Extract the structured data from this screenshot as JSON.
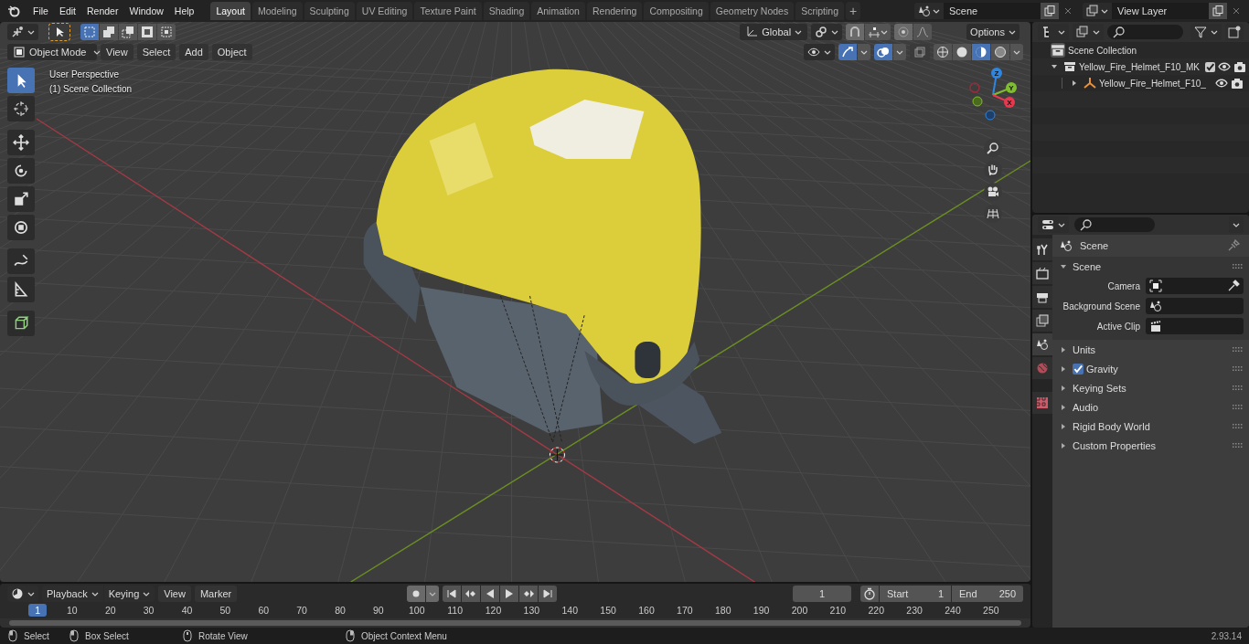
{
  "menu_bar": {
    "menus": [
      "File",
      "Edit",
      "Render",
      "Window",
      "Help"
    ],
    "workspaces": [
      {
        "label": "Layout",
        "selected": true
      },
      {
        "label": "Modeling",
        "selected": false
      },
      {
        "label": "Sculpting",
        "selected": false
      },
      {
        "label": "UV Editing",
        "selected": false
      },
      {
        "label": "Texture Paint",
        "selected": false
      },
      {
        "label": "Shading",
        "selected": false
      },
      {
        "label": "Animation",
        "selected": false
      },
      {
        "label": "Rendering",
        "selected": false
      },
      {
        "label": "Compositing",
        "selected": false
      },
      {
        "label": "Geometry Nodes",
        "selected": false
      },
      {
        "label": "Scripting",
        "selected": false
      }
    ],
    "add_tab": "+",
    "scene": "Scene",
    "view_layer": "View Layer"
  },
  "tool_header": {
    "orientation": "Global",
    "options": "Options"
  },
  "mode_header": {
    "mode": "Object Mode",
    "menus": [
      "View",
      "Select",
      "Add",
      "Object"
    ]
  },
  "toolbar": [
    {
      "kind": "select",
      "selected": true
    },
    {
      "kind": "cursor",
      "selected": false
    },
    {
      "kind": "move",
      "selected": false
    },
    {
      "kind": "rotate",
      "selected": false
    },
    {
      "kind": "scale",
      "selected": false
    },
    {
      "kind": "transform",
      "selected": false
    },
    {
      "kind": "annotate",
      "selected": false
    },
    {
      "kind": "measure",
      "selected": false
    },
    {
      "kind": "add-cube",
      "selected": false
    }
  ],
  "viewport": {
    "info": [
      "User Perspective",
      "(1) Scene Collection"
    ],
    "gizmo_axes": [
      {
        "label": "Z",
        "color": "#2f86e0"
      },
      {
        "label": "Y",
        "color": "#7fbd2e"
      },
      {
        "label": "X",
        "color": "#e8384f"
      }
    ]
  },
  "outliner": {
    "root": "Scene Collection",
    "items": [
      {
        "label": "Yellow_Fire_Helmet_F10_MK",
        "expanded": true,
        "checked": true,
        "kind": "collection",
        "children": [
          {
            "label": "Yellow_Fire_Helmet_F10_",
            "expanded": false,
            "kind": "object"
          }
        ]
      }
    ]
  },
  "properties": {
    "tabs": [
      {
        "kind": "tool",
        "selected": false
      },
      {
        "kind": "render",
        "selected": false
      },
      {
        "kind": "output",
        "selected": false
      },
      {
        "kind": "view-layer",
        "selected": false
      },
      {
        "kind": "scene",
        "selected": true
      },
      {
        "kind": "world",
        "selected": false
      },
      {
        "kind": "texture",
        "selected": false
      }
    ],
    "context": "Scene",
    "panels": [
      {
        "title": "Scene",
        "expanded": true,
        "kind": "plain",
        "fields": [
          {
            "label": "Camera",
            "kind": "camera"
          },
          {
            "label": "Background Scene",
            "kind": "scene"
          },
          {
            "label": "Active Clip",
            "kind": "clip"
          }
        ]
      },
      {
        "title": "Units",
        "expanded": false,
        "kind": "plain"
      },
      {
        "title": "Gravity",
        "expanded": false,
        "kind": "checkbox",
        "checked": true
      },
      {
        "title": "Keying Sets",
        "expanded": false,
        "kind": "plain"
      },
      {
        "title": "Audio",
        "expanded": false,
        "kind": "plain"
      },
      {
        "title": "Rigid Body World",
        "expanded": false,
        "kind": "plain"
      },
      {
        "title": "Custom Properties",
        "expanded": false,
        "kind": "plain"
      }
    ]
  },
  "timeline": {
    "menus": [
      "Playback",
      "Keying",
      "View",
      "Marker"
    ],
    "current_frame": "1",
    "current_frame_marker": "1",
    "start_label": "Start",
    "start": "1",
    "end_label": "End",
    "end": "250",
    "ruler": [
      "10",
      "20",
      "30",
      "40",
      "50",
      "60",
      "70",
      "80",
      "90",
      "100",
      "110",
      "120",
      "130",
      "140",
      "150",
      "160",
      "170",
      "180",
      "190",
      "200",
      "210",
      "220",
      "230",
      "240",
      "250"
    ]
  },
  "status_bar": {
    "hints": [
      {
        "kind": "left",
        "label": "Select"
      },
      {
        "kind": "box",
        "label": "Box Select"
      },
      {
        "kind": "middle",
        "label": "Rotate View"
      },
      {
        "kind": "right",
        "label": "Object Context Menu"
      }
    ],
    "version": "2.93.14"
  }
}
